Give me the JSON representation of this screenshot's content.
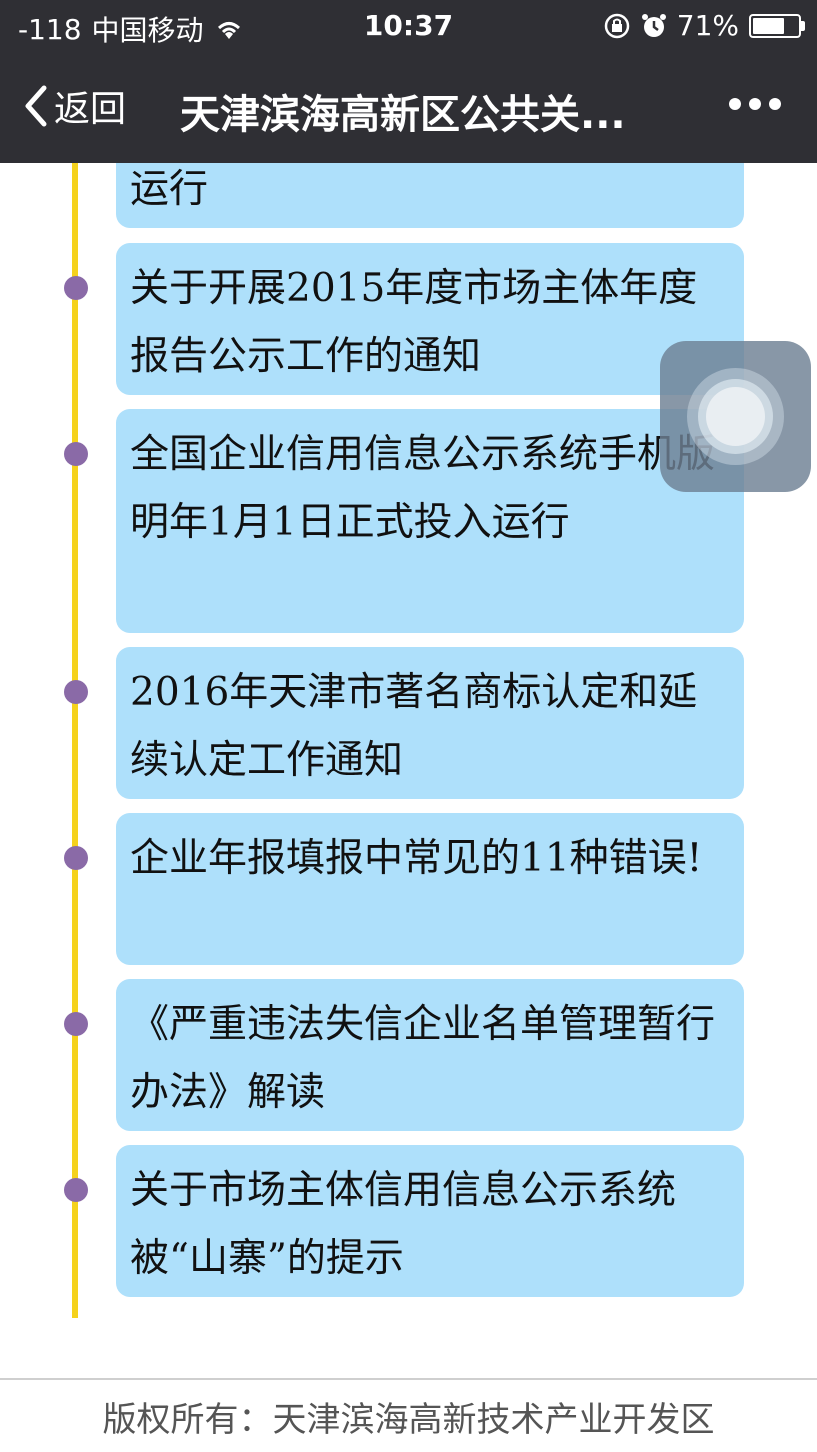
{
  "status_bar": {
    "signal": "-118",
    "carrier": "中国移动",
    "time": "10:37",
    "battery": "71%",
    "battery_level": 0.71
  },
  "nav": {
    "back_label": "返回",
    "title": "天津滨海高新区公共关..."
  },
  "articles": [
    "运行",
    "关于开展2015年度市场主体年度报告公示工作的通知",
    "全国企业信用信息公示系统手机版明年1月1日正式投入运行",
    "2016年天津市著名商标认定和延续认定工作通知",
    "企业年报填报中常见的11种错误!",
    "《严重违法失信企业名单管理暂行办法》解读",
    "关于市场主体信用信息公示系统被“山寨”的提示"
  ],
  "footer": {
    "copyright": "版权所有：天津滨海高新技术产业开发区"
  },
  "colors": {
    "topbar": "#2f2f34",
    "card": "#aee0fb",
    "timeline": "#f5d21c",
    "dot": "#8a6aa7"
  }
}
